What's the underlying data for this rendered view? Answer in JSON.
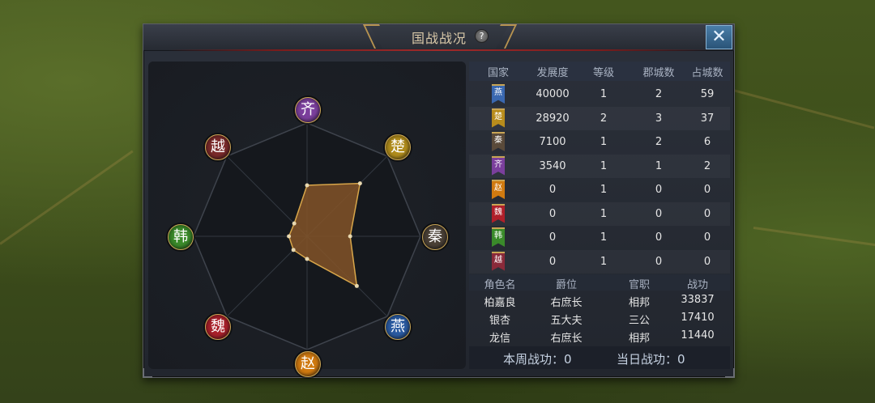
{
  "dialog": {
    "title": "国战战况",
    "help_icon": "?",
    "close_icon": "✕"
  },
  "radar": {
    "axes": [
      {
        "label": "齐",
        "color": "#7b3f9c"
      },
      {
        "label": "楚",
        "color": "#b08c1c"
      },
      {
        "label": "秦",
        "color": "#4a4036"
      },
      {
        "label": "燕",
        "color": "#2a5aa0"
      },
      {
        "label": "赵",
        "color": "#d07a10"
      },
      {
        "label": "魏",
        "color": "#a8202a"
      },
      {
        "label": "韩",
        "color": "#3a8a2a"
      },
      {
        "label": "越",
        "color": "#7a2a2a"
      }
    ]
  },
  "table": {
    "headers": [
      "国家",
      "发展度",
      "等级",
      "郡城数",
      "占城数"
    ],
    "rows": [
      {
        "flag": "燕",
        "flag_color": "#3a68b0",
        "dev": "40000",
        "level": "1",
        "cities": "2",
        "occupied": "59"
      },
      {
        "flag": "楚",
        "flag_color": "#b88c1c",
        "dev": "28920",
        "level": "2",
        "cities": "3",
        "occupied": "37"
      },
      {
        "flag": "秦",
        "flag_color": "#5a4a3a",
        "dev": "7100",
        "level": "1",
        "cities": "2",
        "occupied": "6"
      },
      {
        "flag": "齐",
        "flag_color": "#7b3f9c",
        "dev": "3540",
        "level": "1",
        "cities": "1",
        "occupied": "2"
      },
      {
        "flag": "赵",
        "flag_color": "#d07a10",
        "dev": "0",
        "level": "1",
        "cities": "0",
        "occupied": "0"
      },
      {
        "flag": "魏",
        "flag_color": "#b0202a",
        "dev": "0",
        "level": "1",
        "cities": "0",
        "occupied": "0"
      },
      {
        "flag": "韩",
        "flag_color": "#3a8a2a",
        "dev": "0",
        "level": "1",
        "cities": "0",
        "occupied": "0"
      },
      {
        "flag": "越",
        "flag_color": "#8a2a3a",
        "dev": "0",
        "level": "1",
        "cities": "0",
        "occupied": "0"
      }
    ]
  },
  "ranking": {
    "headers": [
      "角色名",
      "爵位",
      "官职",
      "战功"
    ],
    "rows": [
      {
        "name": "柏嘉良",
        "rank": "右庶长",
        "office": "相邦",
        "merit": "33837"
      },
      {
        "name": "银杏",
        "rank": "五大夫",
        "office": "三公",
        "merit": "17410"
      },
      {
        "name": "龙信",
        "rank": "右庶长",
        "office": "相邦",
        "merit": "11440"
      }
    ]
  },
  "footer": {
    "weekly": "本周战功：0",
    "daily": "当日战功：0"
  }
}
